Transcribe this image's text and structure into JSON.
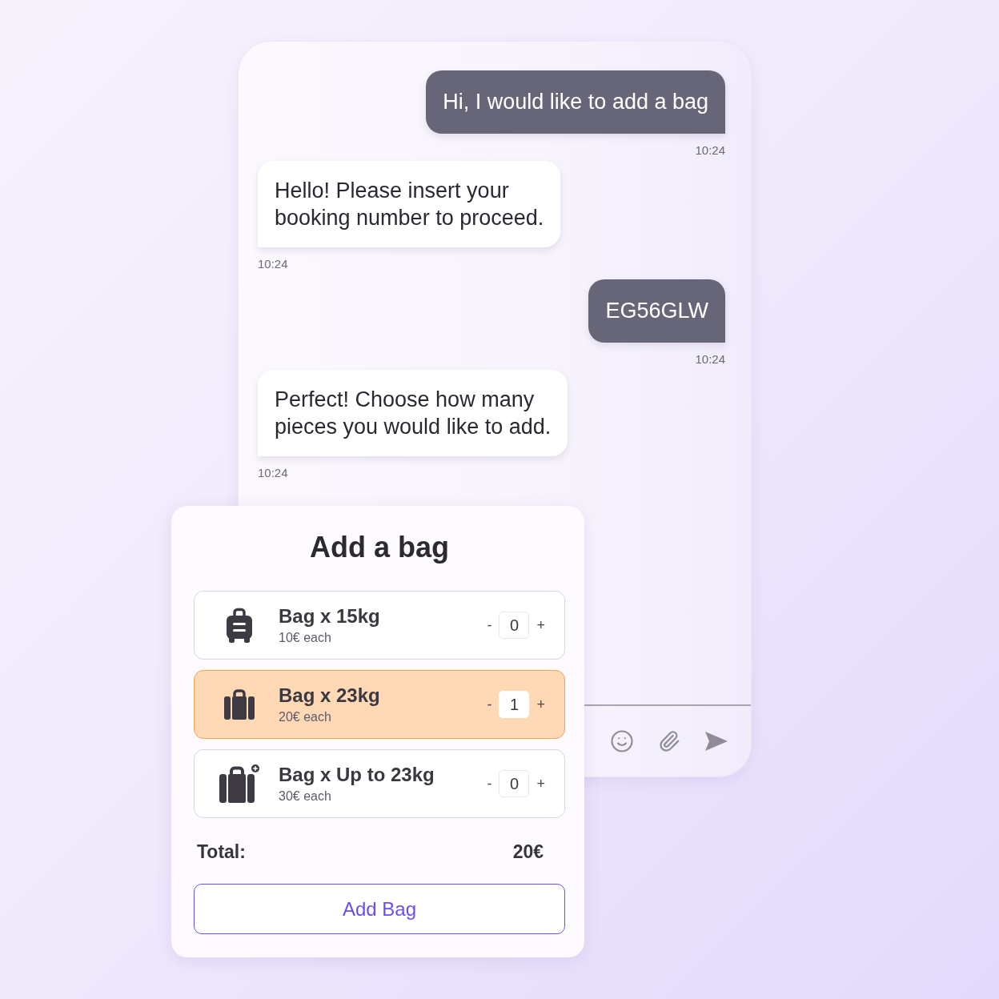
{
  "chat": {
    "messages": [
      {
        "kind": "outgoing",
        "lines": [
          "Hi, I would like to add a bag"
        ],
        "time": "10:24"
      },
      {
        "kind": "incoming",
        "lines": [
          "Hello! Please insert your",
          "booking number to proceed."
        ],
        "time": "10:24"
      },
      {
        "kind": "outgoing",
        "lines": [
          "EG56GLW"
        ],
        "time": "10:24"
      },
      {
        "kind": "incoming",
        "lines": [
          "Perfect! Choose how many",
          "pieces you would like to add."
        ],
        "time": "10:24"
      }
    ]
  },
  "card": {
    "title": "Add a bag",
    "options": [
      {
        "kind": "trolley",
        "name": "Bag x 15kg",
        "price": "10€ each",
        "minus": "-",
        "quantity": "0",
        "plus": "+",
        "selected": false
      },
      {
        "kind": "suitcase",
        "name": "Bag x 23kg",
        "price": "20€ each",
        "minus": "-",
        "quantity": "1",
        "plus": "+",
        "selected": true
      },
      {
        "kind": "suitcase_plus",
        "name": "Bag x Up to 23kg",
        "price": "30€ each",
        "minus": "-",
        "quantity": "0",
        "plus": "+",
        "selected": false
      }
    ],
    "total": {
      "label": "Total:",
      "value": "20€"
    },
    "button": "Add Bag"
  }
}
